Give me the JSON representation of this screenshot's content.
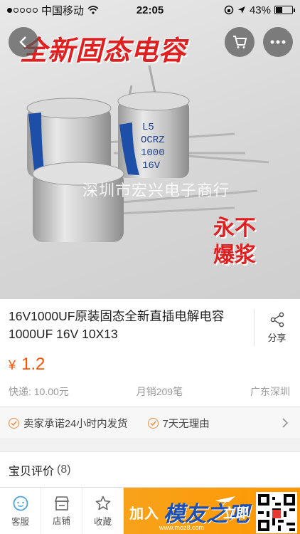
{
  "status_bar": {
    "carrier": "中国移动",
    "time": "22:05",
    "battery": "43%",
    "battery_level": 0.43
  },
  "hero": {
    "headline": "全新固态电容",
    "watermark": "深圳市宏兴电子商行",
    "badge_line1": "永不",
    "badge_line2": "爆浆",
    "capacitor_label": [
      "L5",
      "OCRZ",
      "1000",
      "16V"
    ]
  },
  "product": {
    "title": "16V1000UF原装固态全新直插电解电容1000UF 16V 10X13",
    "share_label": "分享",
    "currency": "¥",
    "price": "1.2",
    "shipping": "快递: 10.00元",
    "monthly_sales": "月销209笔",
    "location": "广东深圳"
  },
  "service": {
    "items": [
      "卖家承诺24小时内发货",
      "7天无理由"
    ]
  },
  "reviews": {
    "label": "宝贝评价",
    "count": "(8)"
  },
  "bottom_bar": {
    "tabs": [
      {
        "label": "客服",
        "icon": "chat-icon"
      },
      {
        "label": "店铺",
        "icon": "shop-icon"
      },
      {
        "label": "收藏",
        "icon": "star-icon"
      }
    ],
    "ad": {
      "prefix": "加入",
      "brand": "模友之吧",
      "cta": "立即",
      "url": "www.moz8.com"
    }
  },
  "colors": {
    "price": "#ff5000",
    "headline": "#e02020",
    "service_icon": "#f08b3e",
    "ad_bg": "#ff9800"
  }
}
